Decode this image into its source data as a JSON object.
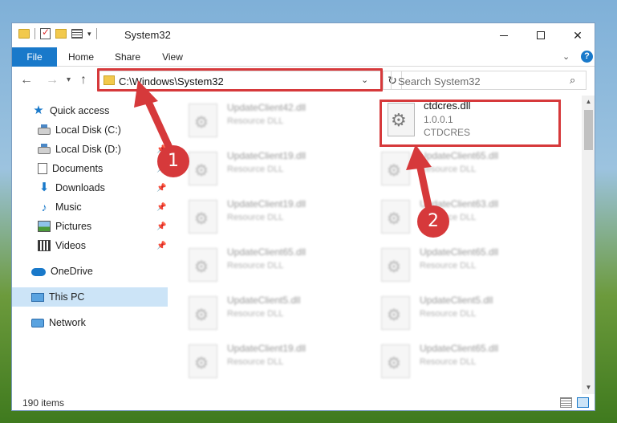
{
  "window": {
    "title": "System32"
  },
  "ribbon": {
    "tabs": [
      "File",
      "Home",
      "Share",
      "View"
    ]
  },
  "address": {
    "path": "C:\\Windows\\System32"
  },
  "search": {
    "placeholder": "Search System32"
  },
  "sidebar": {
    "items": [
      {
        "label": "Quick access",
        "icon": "star-icon"
      },
      {
        "label": "Local Disk (C:)",
        "icon": "drive-icon"
      },
      {
        "label": "Local Disk (D:)",
        "icon": "drive-icon",
        "pinned": true
      },
      {
        "label": "Documents",
        "icon": "documents-icon",
        "pinned": true
      },
      {
        "label": "Downloads",
        "icon": "download-icon",
        "pinned": true
      },
      {
        "label": "Music",
        "icon": "music-icon",
        "pinned": true
      },
      {
        "label": "Pictures",
        "icon": "pictures-icon",
        "pinned": true
      },
      {
        "label": "Videos",
        "icon": "videos-icon",
        "pinned": true
      },
      {
        "label": "OneDrive",
        "icon": "cloud-icon"
      },
      {
        "label": "This PC",
        "icon": "computer-icon",
        "selected": true
      },
      {
        "label": "Network",
        "icon": "network-icon"
      }
    ]
  },
  "files": {
    "left": [
      {
        "name": "UpdateClient42.dll",
        "type": "Resource DLL"
      },
      {
        "name": "UpdateClient19.dll",
        "type": "Resource DLL"
      },
      {
        "name": "UpdateClient19.dll",
        "type": "Resource DLL"
      },
      {
        "name": "UpdateClient65.dll",
        "type": "Resource DLL"
      },
      {
        "name": "UpdateClient5.dll",
        "type": "Resource DLL"
      },
      {
        "name": "UpdateClient19.dll",
        "type": "Resource DLL"
      }
    ],
    "right": [
      {
        "name": "UpdateClient65.dll",
        "type": "Resource DLL"
      },
      {
        "name": "UpdateClient63.dll",
        "type": "Resource DLL"
      },
      {
        "name": "UpdateClient65.dll",
        "type": "Resource DLL"
      },
      {
        "name": "UpdateClient5.dll",
        "type": "Resource DLL"
      },
      {
        "name": "UpdateClient65.dll",
        "type": "Resource DLL"
      }
    ],
    "featured": {
      "name": "ctdcres.dll",
      "version": "1.0.0.1",
      "description": "CTDCRES"
    }
  },
  "status": {
    "count": "190 items"
  },
  "annotations": {
    "badge1": "1",
    "badge2": "2",
    "color": "#d6393b"
  },
  "colors": {
    "accent": "#1979ca",
    "selection": "#cce4f7"
  }
}
